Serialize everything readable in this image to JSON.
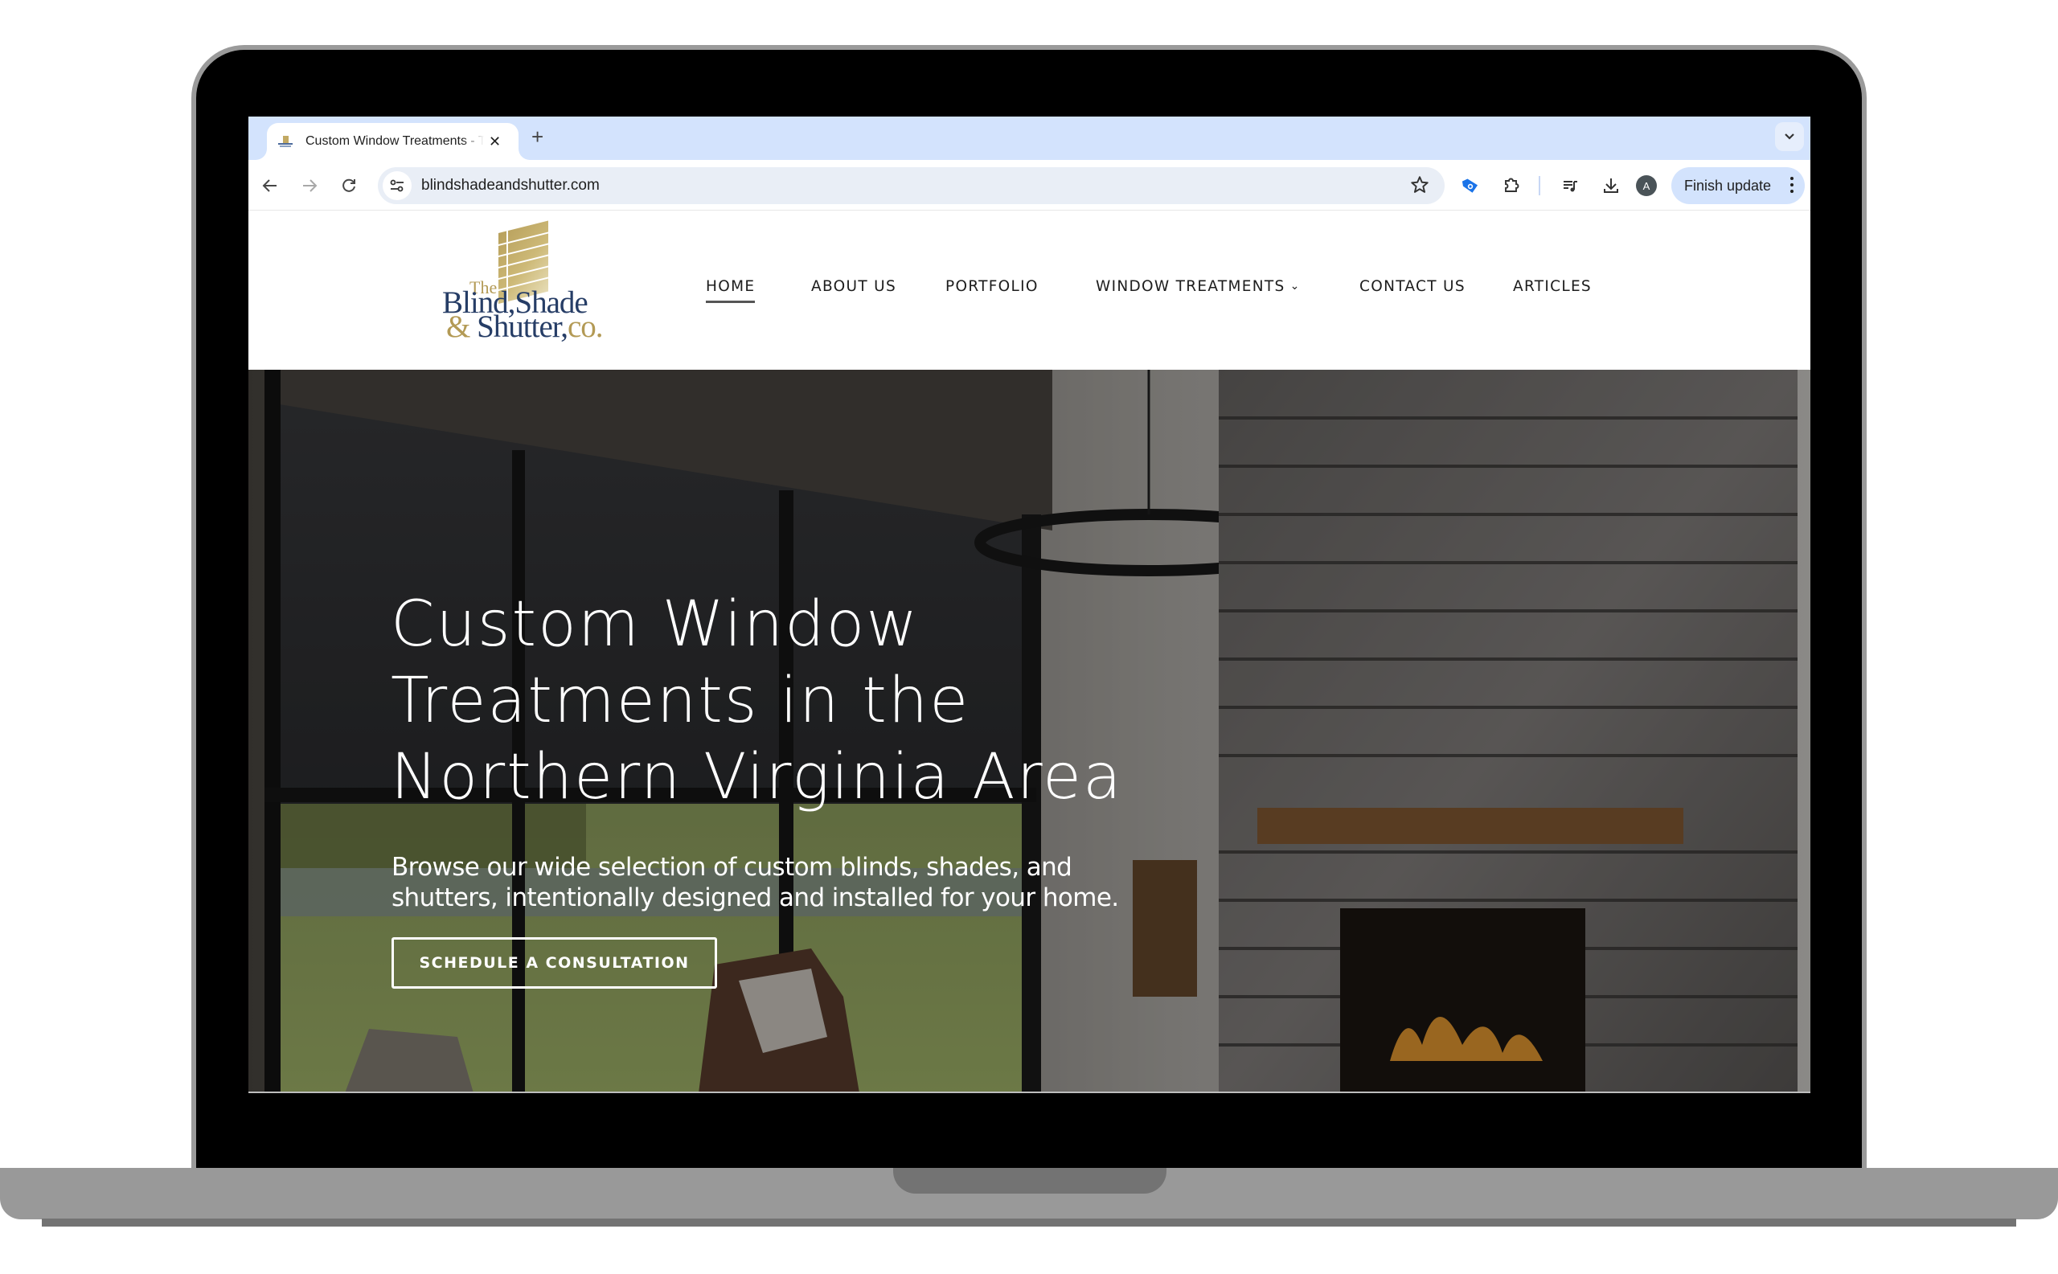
{
  "browser": {
    "tab": {
      "title": "Custom Window Treatments - The Blind, Shade & Shutter Co.",
      "favicon": "company-logo-favicon"
    },
    "new_tab_label": "+",
    "address_bar": {
      "url": "blindshadeandshutter.com"
    },
    "finish_update_label": "Finish update",
    "profile_initial": "A",
    "icons": {
      "back": "←",
      "forward": "→",
      "reload": "↻",
      "close": "✕",
      "tab_search": "⌄",
      "star": "☆"
    }
  },
  "site": {
    "logo": {
      "the": "The",
      "line1": "Blind,Shade",
      "line2_amp": "&",
      "line2_main": " Shutter,",
      "line2_co": "co."
    },
    "nav": [
      {
        "label": "HOME",
        "active": true
      },
      {
        "label": "ABOUT US"
      },
      {
        "label": "PORTFOLIO"
      },
      {
        "label": "WINDOW TREATMENTS",
        "has_dropdown": true
      },
      {
        "label": "CONTACT US"
      },
      {
        "label": "ARTICLES"
      }
    ],
    "hero": {
      "title_lines": [
        "Custom Window",
        "Treatments in the",
        "Northern Virginia Area"
      ],
      "subtitle_lines": [
        "Browse our wide selection of custom blinds, shades, and",
        "shutters, intentionally designed and installed for your home."
      ],
      "cta_label": "SCHEDULE A CONSULTATION"
    },
    "colors": {
      "brand_navy": "#263d66",
      "brand_gold": "#b39a55",
      "tabstrip_bg": "#d3e3fd"
    }
  }
}
